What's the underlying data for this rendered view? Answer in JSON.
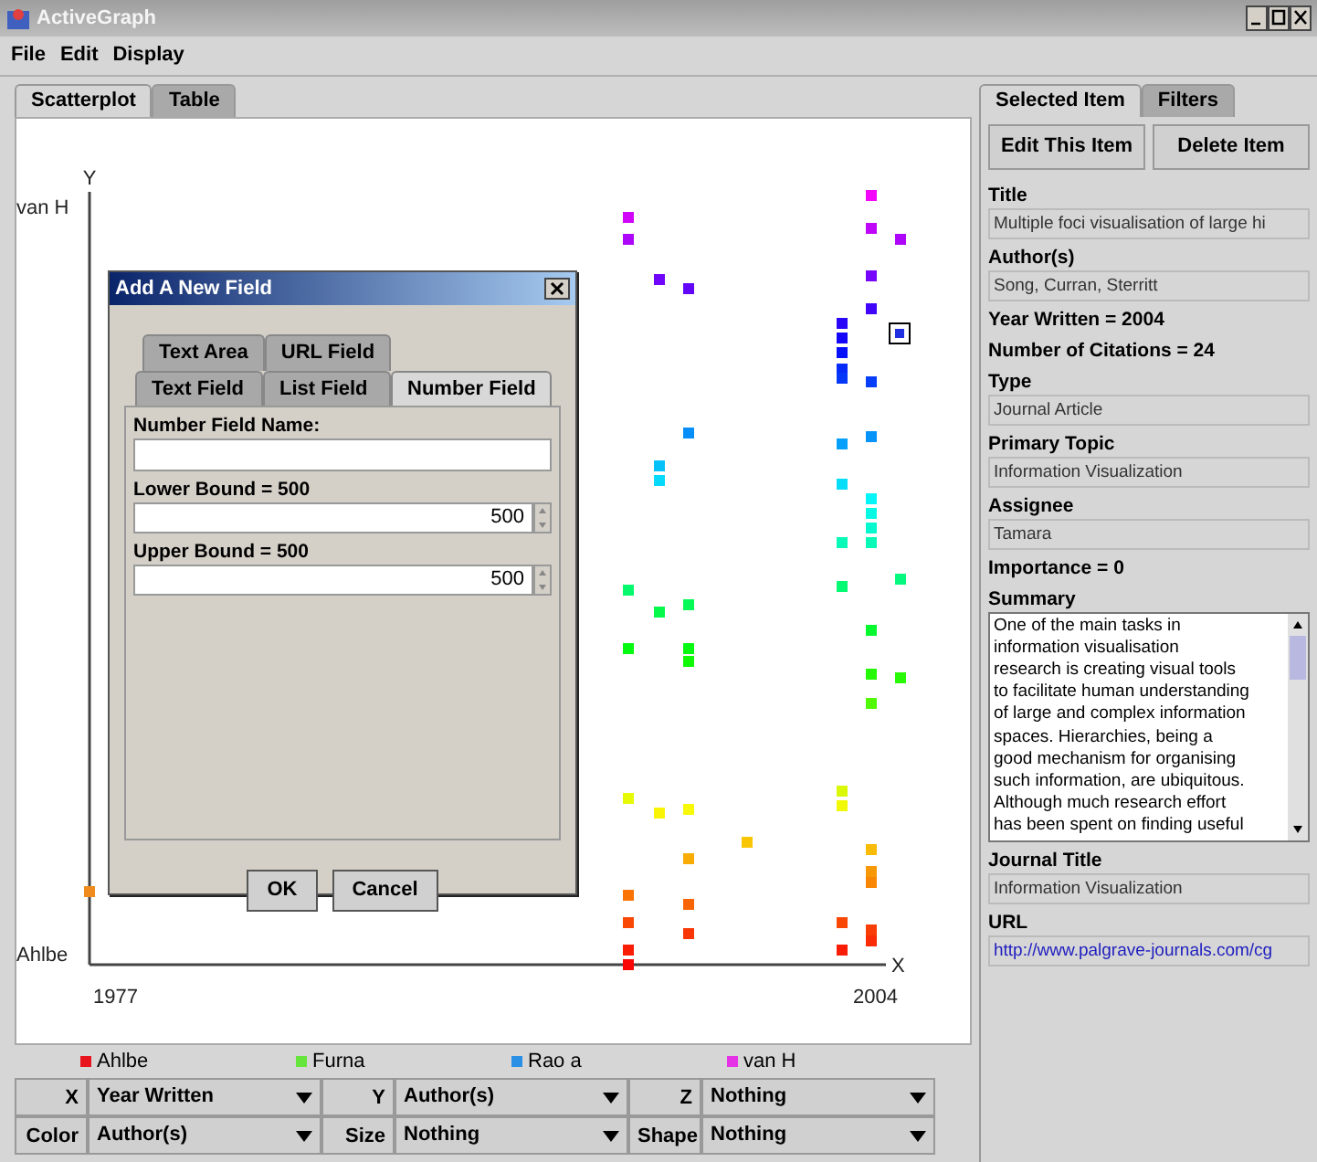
{
  "window": {
    "title": "ActiveGraph"
  },
  "menu": [
    "File",
    "Edit",
    "Display"
  ],
  "main_tabs": [
    {
      "label": "Scatterplot",
      "selected": true
    },
    {
      "label": "Table",
      "selected": false
    }
  ],
  "scatterplot": {
    "y_axis": "Y",
    "x_axis": "X",
    "y_top": "van H",
    "y_bottom": "Ahlbe",
    "x_min": "1977",
    "x_max": "2004",
    "legend": [
      {
        "label": "Ahlbe",
        "color": "#e8141e"
      },
      {
        "label": "Furna",
        "color": "#66e63c"
      },
      {
        "label": "Rao a",
        "color": "#2a90e6"
      },
      {
        "label": "van H",
        "color": "#e632e6"
      }
    ]
  },
  "axis_controls": [
    {
      "label": "X",
      "value": "Year Written"
    },
    {
      "label": "Y",
      "value": "Author(s)"
    },
    {
      "label": "Z",
      "value": "Nothing"
    },
    {
      "label": "Color",
      "value": "Author(s)"
    },
    {
      "label": "Size",
      "value": "Nothing"
    },
    {
      "label": "Shape",
      "value": "Nothing"
    }
  ],
  "dialog": {
    "title": "Add A New Field",
    "tab_rows": [
      [
        {
          "label": "Text Area",
          "selected": false
        },
        {
          "label": "URL Field",
          "selected": false
        }
      ],
      [
        {
          "label": "Text Field",
          "selected": false
        },
        {
          "label": "List Field",
          "selected": false
        },
        {
          "label": "Number Field",
          "selected": true
        }
      ]
    ],
    "fields": [
      {
        "kind": "text",
        "label": "Number Field Name:"
      },
      {
        "kind": "spinner",
        "label": "Lower Bound = 500",
        "value": "500"
      },
      {
        "kind": "spinner",
        "label": "Upper Bound = 500",
        "value": "500"
      }
    ],
    "buttons": [
      "OK",
      "Cancel"
    ]
  },
  "side_tabs": [
    {
      "label": "Selected Item",
      "selected": true
    },
    {
      "label": "Filters",
      "selected": false
    }
  ],
  "side_buttons": [
    "Edit This Item",
    "Delete Item"
  ],
  "details": [
    {
      "kind": "field",
      "label": "Title",
      "value": "Multiple foci visualisation of large hi"
    },
    {
      "kind": "field",
      "label": "Author(s)",
      "value": "Song, Curran, Sterritt"
    },
    {
      "kind": "line",
      "label": "Year Written = 2004"
    },
    {
      "kind": "line",
      "label": "Number of Citations = 24"
    },
    {
      "kind": "field",
      "label": "Type",
      "value": "Journal Article"
    },
    {
      "kind": "field",
      "label": "Primary Topic",
      "value": "Information Visualization"
    },
    {
      "kind": "field",
      "label": "Assignee",
      "value": "Tamara"
    },
    {
      "kind": "line",
      "label": "Importance = 0"
    },
    {
      "kind": "textarea",
      "label": "Summary",
      "value": "One of the main tasks in\ninformation visualisation\nresearch is creating visual tools\nto facilitate human understanding\nof large and complex information\nspaces. Hierarchies, being a\ngood mechanism for organising\nsuch information, are ubiquitous.\nAlthough much research effort\nhas been spent on finding useful"
    },
    {
      "kind": "field",
      "label": "Journal Title",
      "value": "Information Visualization"
    },
    {
      "kind": "link",
      "label": "URL",
      "value": "http://www.palgrave-journals.com/cg"
    }
  ]
}
